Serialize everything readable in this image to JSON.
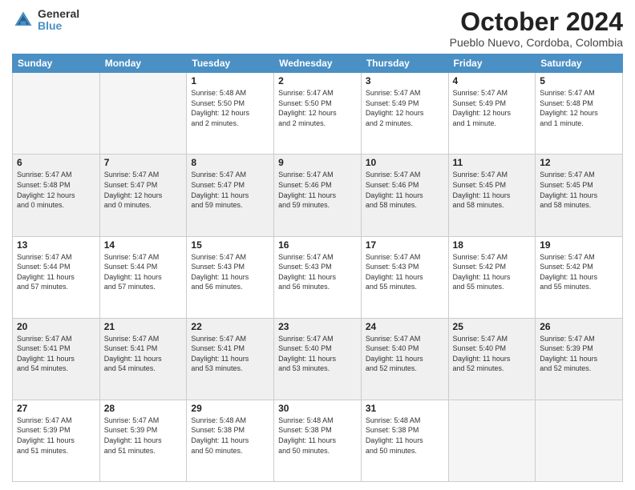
{
  "logo": {
    "general": "General",
    "blue": "Blue"
  },
  "header": {
    "month": "October 2024",
    "location": "Pueblo Nuevo, Cordoba, Colombia"
  },
  "weekdays": [
    "Sunday",
    "Monday",
    "Tuesday",
    "Wednesday",
    "Thursday",
    "Friday",
    "Saturday"
  ],
  "weeks": [
    {
      "shade": false,
      "days": [
        {
          "num": "",
          "info": ""
        },
        {
          "num": "",
          "info": ""
        },
        {
          "num": "1",
          "info": "Sunrise: 5:48 AM\nSunset: 5:50 PM\nDaylight: 12 hours\nand 2 minutes."
        },
        {
          "num": "2",
          "info": "Sunrise: 5:47 AM\nSunset: 5:50 PM\nDaylight: 12 hours\nand 2 minutes."
        },
        {
          "num": "3",
          "info": "Sunrise: 5:47 AM\nSunset: 5:49 PM\nDaylight: 12 hours\nand 2 minutes."
        },
        {
          "num": "4",
          "info": "Sunrise: 5:47 AM\nSunset: 5:49 PM\nDaylight: 12 hours\nand 1 minute."
        },
        {
          "num": "5",
          "info": "Sunrise: 5:47 AM\nSunset: 5:48 PM\nDaylight: 12 hours\nand 1 minute."
        }
      ]
    },
    {
      "shade": true,
      "days": [
        {
          "num": "6",
          "info": "Sunrise: 5:47 AM\nSunset: 5:48 PM\nDaylight: 12 hours\nand 0 minutes."
        },
        {
          "num": "7",
          "info": "Sunrise: 5:47 AM\nSunset: 5:47 PM\nDaylight: 12 hours\nand 0 minutes."
        },
        {
          "num": "8",
          "info": "Sunrise: 5:47 AM\nSunset: 5:47 PM\nDaylight: 11 hours\nand 59 minutes."
        },
        {
          "num": "9",
          "info": "Sunrise: 5:47 AM\nSunset: 5:46 PM\nDaylight: 11 hours\nand 59 minutes."
        },
        {
          "num": "10",
          "info": "Sunrise: 5:47 AM\nSunset: 5:46 PM\nDaylight: 11 hours\nand 58 minutes."
        },
        {
          "num": "11",
          "info": "Sunrise: 5:47 AM\nSunset: 5:45 PM\nDaylight: 11 hours\nand 58 minutes."
        },
        {
          "num": "12",
          "info": "Sunrise: 5:47 AM\nSunset: 5:45 PM\nDaylight: 11 hours\nand 58 minutes."
        }
      ]
    },
    {
      "shade": false,
      "days": [
        {
          "num": "13",
          "info": "Sunrise: 5:47 AM\nSunset: 5:44 PM\nDaylight: 11 hours\nand 57 minutes."
        },
        {
          "num": "14",
          "info": "Sunrise: 5:47 AM\nSunset: 5:44 PM\nDaylight: 11 hours\nand 57 minutes."
        },
        {
          "num": "15",
          "info": "Sunrise: 5:47 AM\nSunset: 5:43 PM\nDaylight: 11 hours\nand 56 minutes."
        },
        {
          "num": "16",
          "info": "Sunrise: 5:47 AM\nSunset: 5:43 PM\nDaylight: 11 hours\nand 56 minutes."
        },
        {
          "num": "17",
          "info": "Sunrise: 5:47 AM\nSunset: 5:43 PM\nDaylight: 11 hours\nand 55 minutes."
        },
        {
          "num": "18",
          "info": "Sunrise: 5:47 AM\nSunset: 5:42 PM\nDaylight: 11 hours\nand 55 minutes."
        },
        {
          "num": "19",
          "info": "Sunrise: 5:47 AM\nSunset: 5:42 PM\nDaylight: 11 hours\nand 55 minutes."
        }
      ]
    },
    {
      "shade": true,
      "days": [
        {
          "num": "20",
          "info": "Sunrise: 5:47 AM\nSunset: 5:41 PM\nDaylight: 11 hours\nand 54 minutes."
        },
        {
          "num": "21",
          "info": "Sunrise: 5:47 AM\nSunset: 5:41 PM\nDaylight: 11 hours\nand 54 minutes."
        },
        {
          "num": "22",
          "info": "Sunrise: 5:47 AM\nSunset: 5:41 PM\nDaylight: 11 hours\nand 53 minutes."
        },
        {
          "num": "23",
          "info": "Sunrise: 5:47 AM\nSunset: 5:40 PM\nDaylight: 11 hours\nand 53 minutes."
        },
        {
          "num": "24",
          "info": "Sunrise: 5:47 AM\nSunset: 5:40 PM\nDaylight: 11 hours\nand 52 minutes."
        },
        {
          "num": "25",
          "info": "Sunrise: 5:47 AM\nSunset: 5:40 PM\nDaylight: 11 hours\nand 52 minutes."
        },
        {
          "num": "26",
          "info": "Sunrise: 5:47 AM\nSunset: 5:39 PM\nDaylight: 11 hours\nand 52 minutes."
        }
      ]
    },
    {
      "shade": false,
      "days": [
        {
          "num": "27",
          "info": "Sunrise: 5:47 AM\nSunset: 5:39 PM\nDaylight: 11 hours\nand 51 minutes."
        },
        {
          "num": "28",
          "info": "Sunrise: 5:47 AM\nSunset: 5:39 PM\nDaylight: 11 hours\nand 51 minutes."
        },
        {
          "num": "29",
          "info": "Sunrise: 5:48 AM\nSunset: 5:38 PM\nDaylight: 11 hours\nand 50 minutes."
        },
        {
          "num": "30",
          "info": "Sunrise: 5:48 AM\nSunset: 5:38 PM\nDaylight: 11 hours\nand 50 minutes."
        },
        {
          "num": "31",
          "info": "Sunrise: 5:48 AM\nSunset: 5:38 PM\nDaylight: 11 hours\nand 50 minutes."
        },
        {
          "num": "",
          "info": ""
        },
        {
          "num": "",
          "info": ""
        }
      ]
    }
  ]
}
